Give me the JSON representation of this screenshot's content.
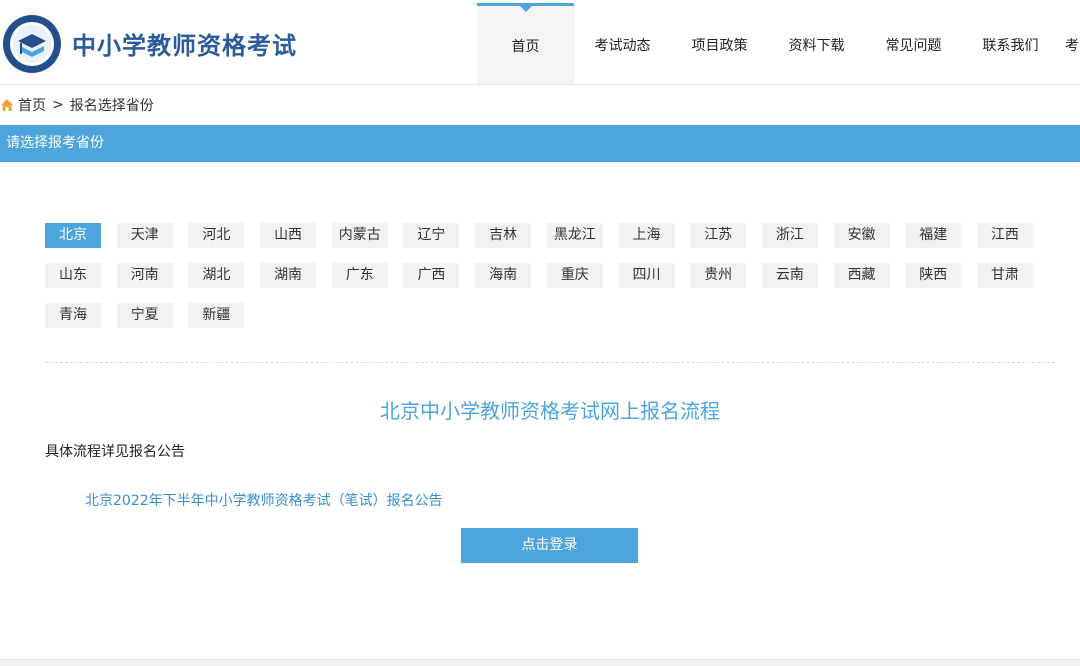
{
  "header": {
    "site_title": "中小学教师资格考试",
    "nav": [
      "首页",
      "考试动态",
      "项目政策",
      "资料下载",
      "常见问题",
      "联系我们",
      "考"
    ]
  },
  "breadcrumb": {
    "home": "首页",
    "separator": ">",
    "current": "报名选择省份"
  },
  "banner": {
    "title": "请选择报考省份"
  },
  "provinces": [
    "北京",
    "天津",
    "河北",
    "山西",
    "内蒙古",
    "辽宁",
    "吉林",
    "黑龙江",
    "上海",
    "江苏",
    "浙江",
    "安徽",
    "福建",
    "江西",
    "山东",
    "河南",
    "湖北",
    "湖南",
    "广东",
    "广西",
    "海南",
    "重庆",
    "四川",
    "贵州",
    "云南",
    "西藏",
    "陕西",
    "甘肃",
    "青海",
    "宁夏",
    "新疆"
  ],
  "selected_province": "北京",
  "content": {
    "section_title": "北京中小学教师资格考试网上报名流程",
    "detail_label": "具体流程详见报名公告",
    "notice_link": "北京2022年下半年中小学教师资格考试（笔试）报名公告",
    "login_button": "点击登录"
  },
  "colors": {
    "accent": "#4ca6dd",
    "brand": "#2a5b9a",
    "link": "#3a8fcf"
  },
  "icons": {
    "logo": "education-book-logo",
    "home": "home-icon"
  }
}
